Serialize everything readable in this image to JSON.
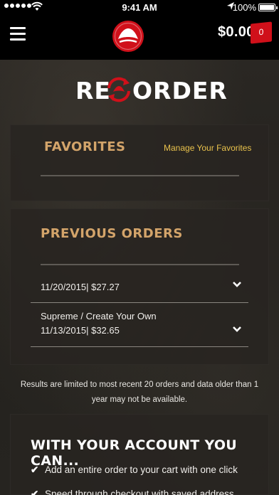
{
  "status_bar": {
    "time": "9:41 AM",
    "battery": "100%"
  },
  "header": {
    "cart_total": "$0.00",
    "cart_count": "0"
  },
  "title": {
    "part1": "RE",
    "part2": "ORDER"
  },
  "favorites": {
    "title": "FAVORITES",
    "manage_link": "Manage Your Favorites"
  },
  "previous_orders": {
    "title": "PREVIOUS ORDERS",
    "orders": [
      {
        "name": "",
        "date_price": "11/20/2015| $27.27"
      },
      {
        "name": "Supreme / Create Your Own",
        "date_price": "11/13/2015| $32.65"
      }
    ]
  },
  "notice": "Results are limited to most recent 20 orders and data older than 1 year may not be available.",
  "account": {
    "title": "WITH YOUR ACCOUNT YOU CAN...",
    "benefits": [
      "Add an entire order to your cart with one click",
      "Speed through checkout with saved address"
    ]
  },
  "colors": {
    "accent_red": "#d0101a",
    "section_gold": "#d3a46a",
    "link_yellow": "#e9c24c"
  }
}
